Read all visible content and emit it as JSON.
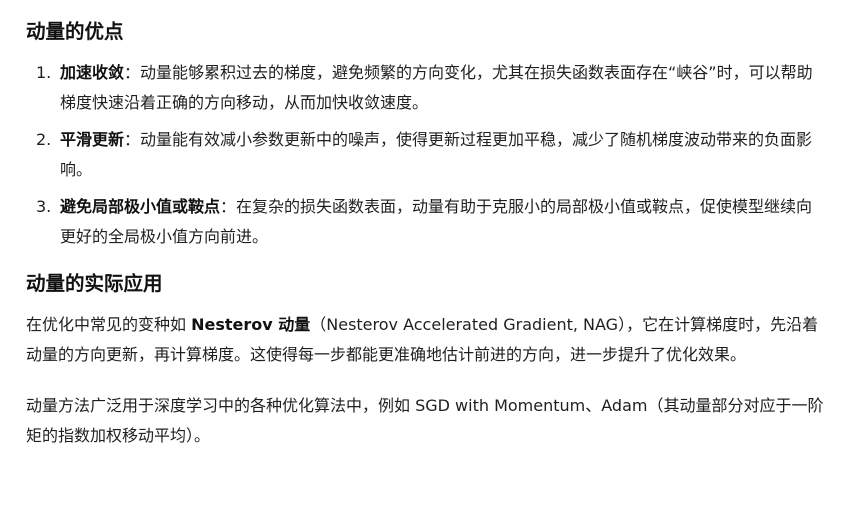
{
  "section1": {
    "title": "动量的优点",
    "items": [
      {
        "num": "1.",
        "term": "加速收敛",
        "desc": "：动量能够累积过去的梯度，避免频繁的方向变化，尤其在损失函数表面存在“峡谷”时，可以帮助梯度快速沿着正确的方向移动，从而加快收敛速度。"
      },
      {
        "num": "2.",
        "term": "平滑更新",
        "desc": "：动量能有效减小参数更新中的噪声，使得更新过程更加平稳，减少了随机梯度波动带来的负面影响。"
      },
      {
        "num": "3.",
        "term": "避免局部极小值或鞍点",
        "desc": "：在复杂的损失函数表面，动量有助于克服小的局部极小值或鞍点，促使模型继续向更好的全局极小值方向前进。"
      }
    ]
  },
  "section2": {
    "title": "动量的实际应用",
    "para1": {
      "pre": "在优化中常见的变种如 ",
      "strong": "Nesterov 动量",
      "post": "（Nesterov Accelerated Gradient, NAG），它在计算梯度时，先沿着动量的方向更新，再计算梯度。这使得每一步都能更准确地估计前进的方向，进一步提升了优化效果。"
    },
    "para2": "动量方法广泛用于深度学习中的各种优化算法中，例如 SGD with Momentum、Adam（其动量部分对应于一阶矩的指数加权移动平均）。"
  }
}
